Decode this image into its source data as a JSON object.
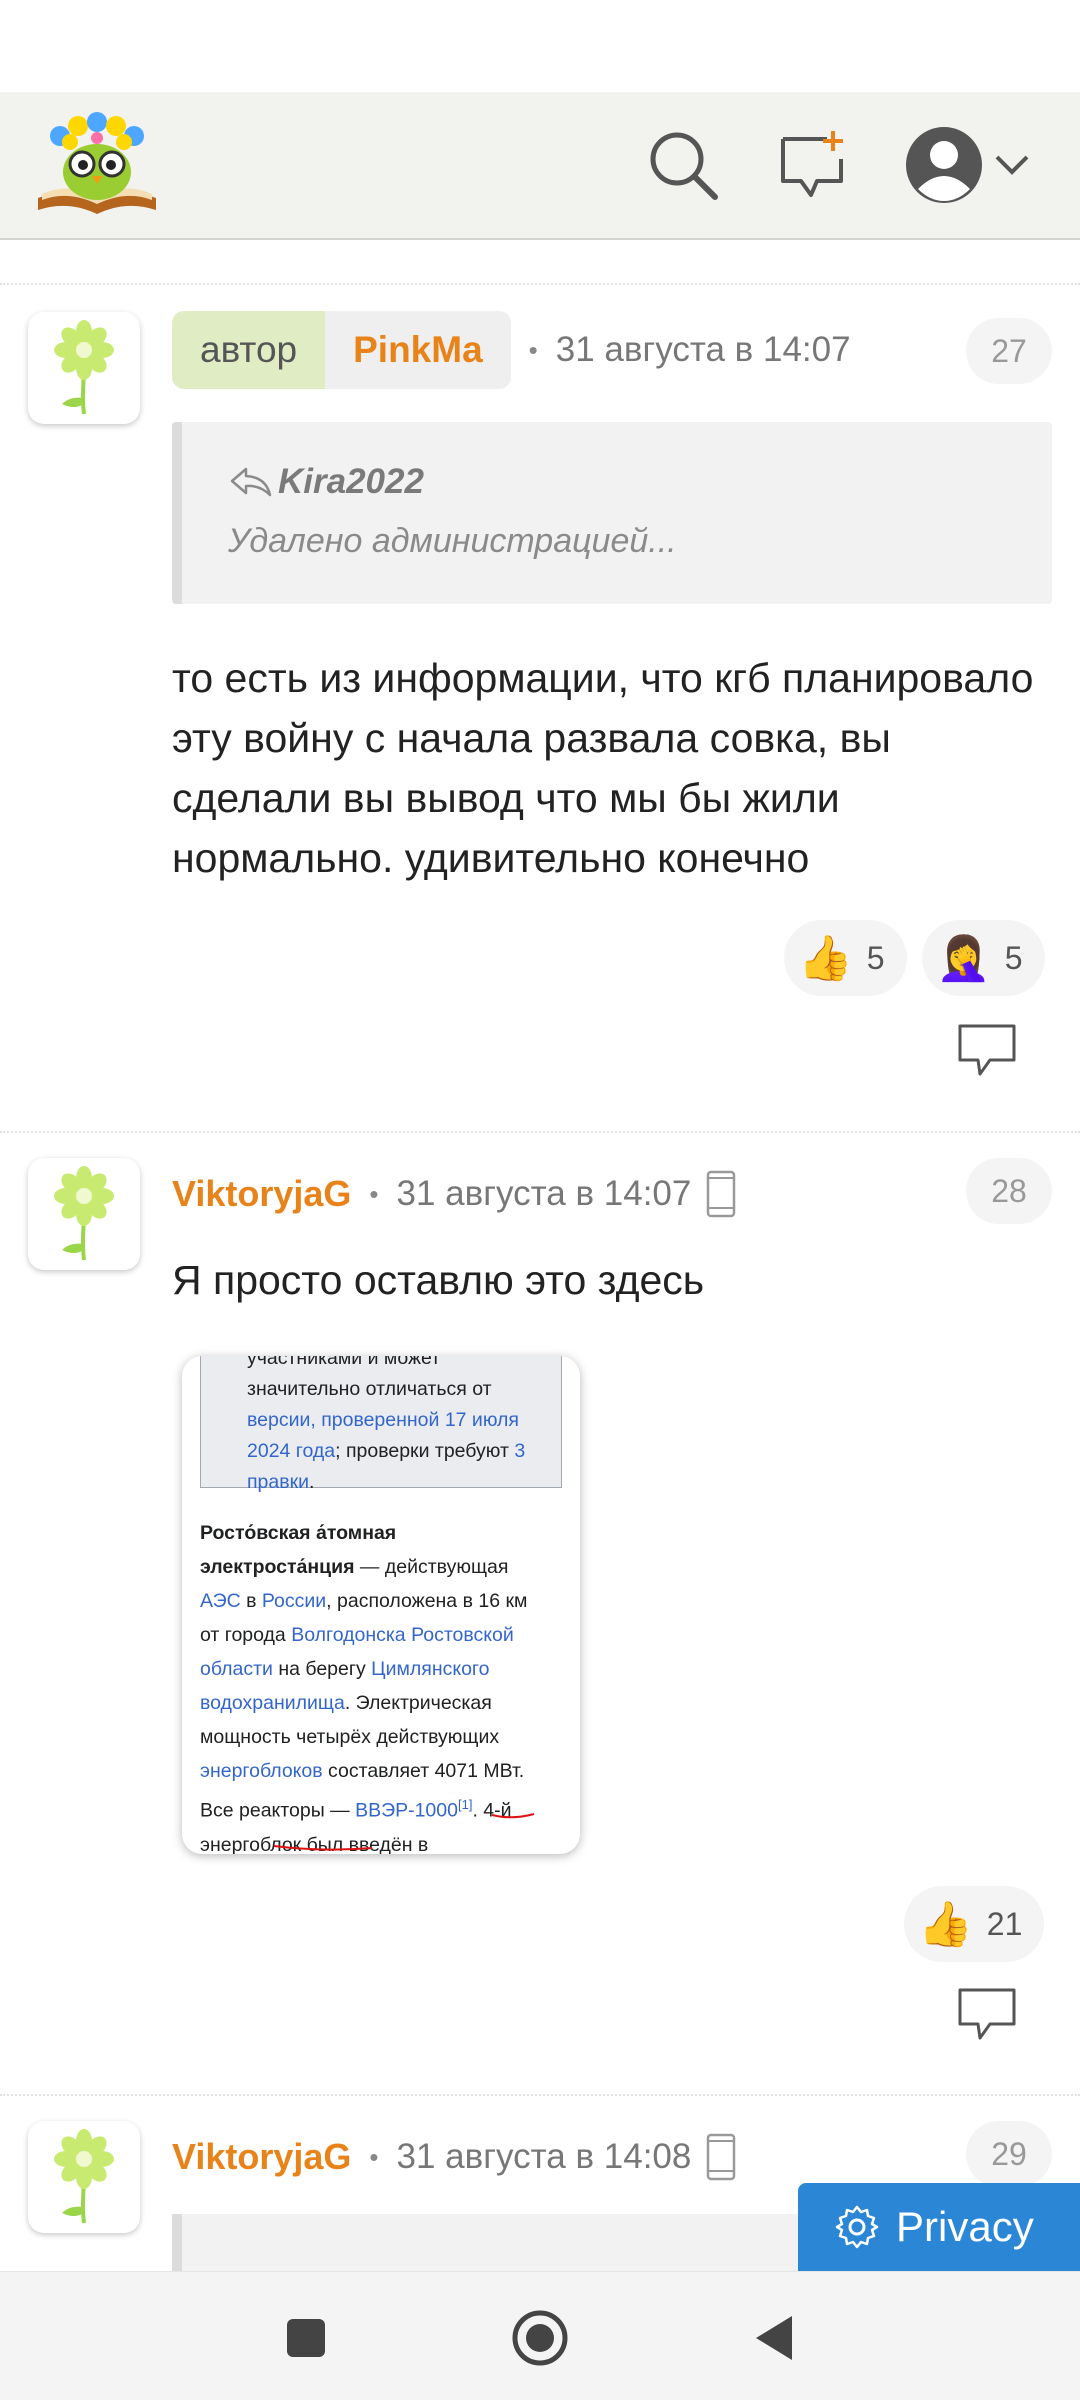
{
  "topbar": {
    "logo_icon": "owl-on-book-logo",
    "search_icon": "search-icon",
    "new_post_icon": "new-post-icon",
    "profile_icon": "profile-icon",
    "menu_icon": "chevron-down-icon"
  },
  "comments": [
    {
      "number": "27",
      "author_badge": "автор",
      "username": "PinkMa",
      "time": "31 августа в 14:07",
      "quote": {
        "author": "Kira2022",
        "text": "Удалено администрацией..."
      },
      "text": "то есть из информации, что кгб планировало эту войну с начала развала совка, вы сделали вы вывод что мы бы жили нормально. удивительно конечно",
      "reactions": [
        {
          "emoji": "👍",
          "count": "5"
        },
        {
          "emoji": "🤦‍♀️",
          "count": "5"
        }
      ]
    },
    {
      "number": "28",
      "username": "ViktoryjaG",
      "time": "31 августа в 14:07",
      "text": "Я просто оставлю это здесь",
      "screenshot": {
        "notice_line1": "участниками и может",
        "notice_line2": "значительно отличаться от",
        "notice_link1": "версии, проверенной 17 июля",
        "notice_link2": "2024 года",
        "notice_tail": "; проверки требуют ",
        "notice_link3": "3",
        "notice_link4": "правки",
        "notice_end": ".",
        "title_bold1": "Росто́вская а́томная",
        "title_bold2": "электроста́нция",
        "t1": " — действующая",
        "l_aes": "АЭС",
        "t2": " в ",
        "l_russia": "России",
        "t3": ", расположена в 16 км",
        "t4": "от города ",
        "l_volgo1": "Волгодонска Ростовской",
        "l_volgo2": "области",
        "t5": " на берегу ",
        "l_tsiml1": "Цимлянского",
        "l_tsiml2": "водохранилища",
        "t6": ". Электрическая",
        "t7": "мощность четырёх действующих",
        "l_energo": "энергоблоков",
        "t8": " составляет 4071 МВт.",
        "t9": "Все реакторы — ",
        "l_vver": "ВВЭР-1000",
        "l_ref": "[1]",
        "t10": ". 4-й",
        "t11": "энергоблок был введён в"
      },
      "reactions": [
        {
          "emoji": "👍",
          "count": "21"
        }
      ]
    },
    {
      "number": "29",
      "username": "ViktoryjaG",
      "time": "31 августа в 14:08"
    }
  ],
  "privacy_button": "Privacy",
  "colors": {
    "accent_orange": "#e8831a",
    "author_badge_bg": "#e0edc4",
    "privacy_blue": "#2b86d6",
    "link_blue": "#3366cc"
  }
}
